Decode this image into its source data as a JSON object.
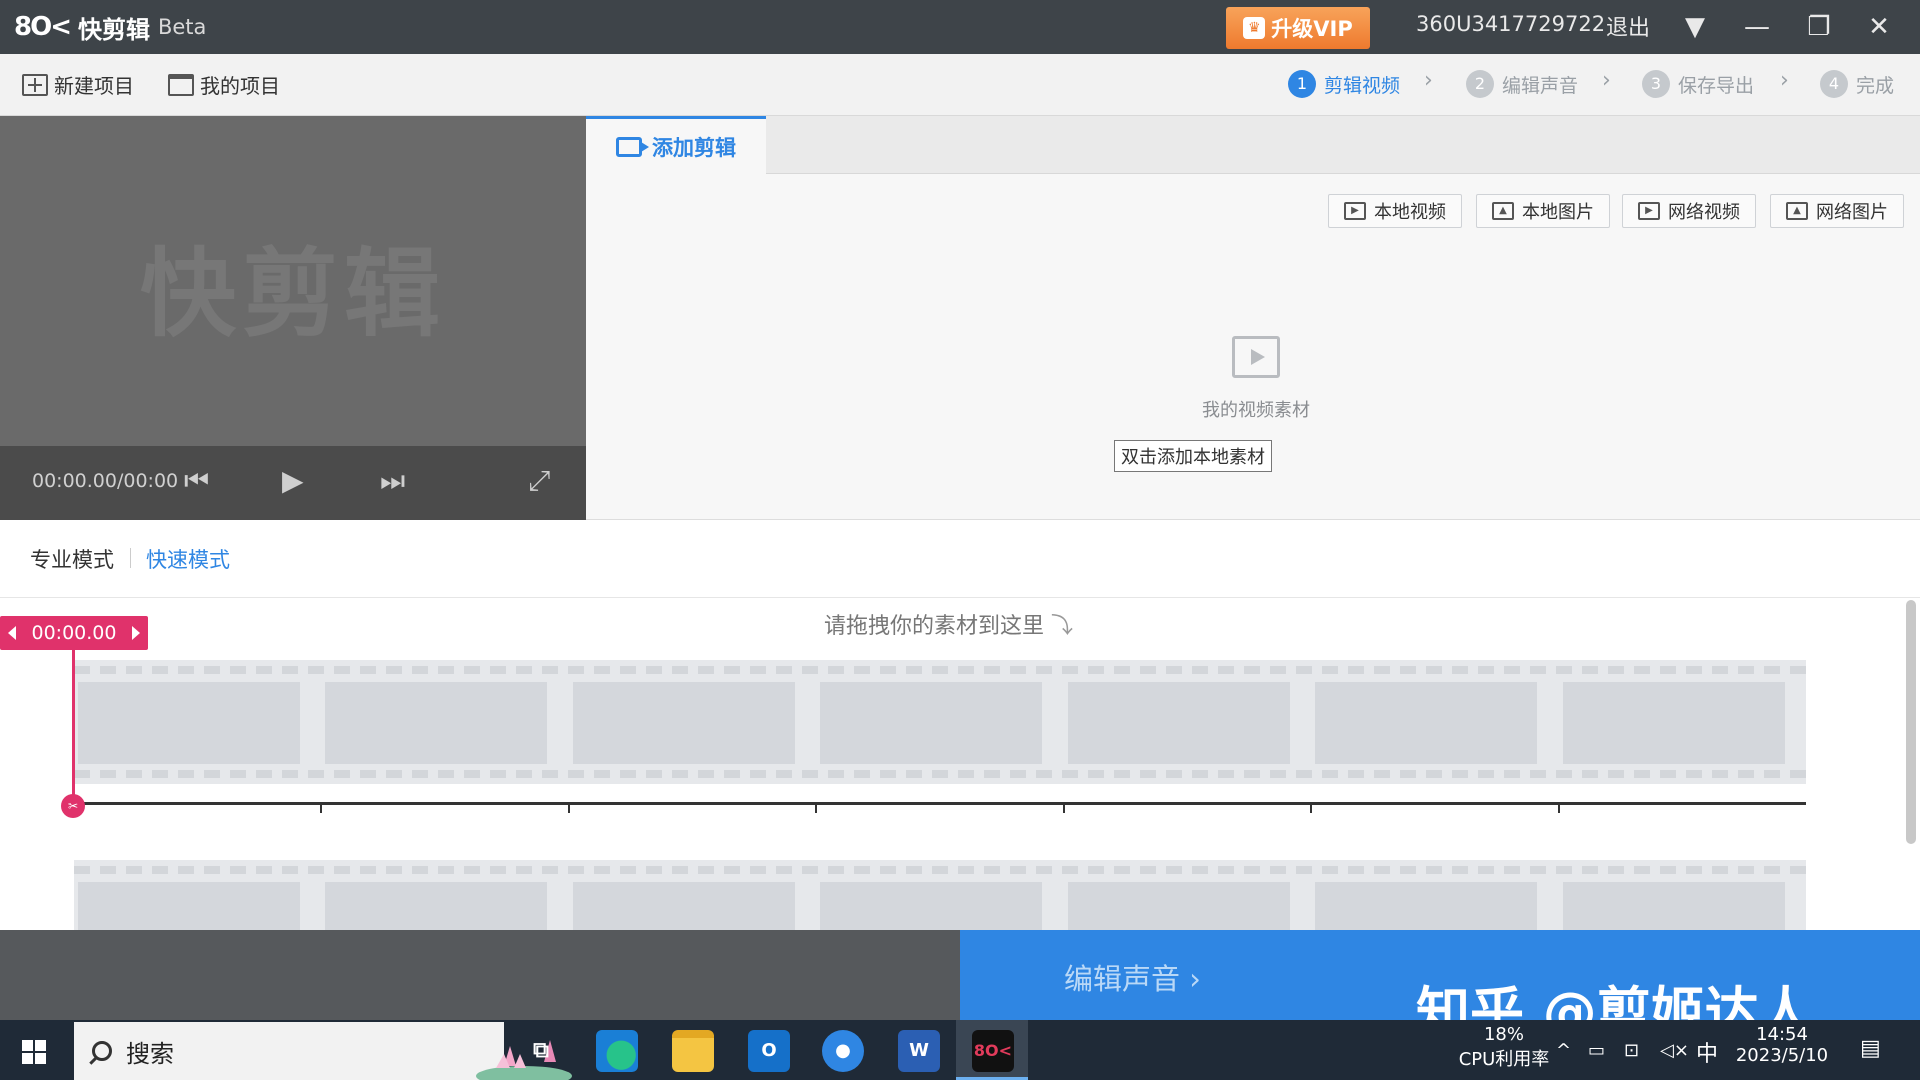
{
  "app": {
    "brand_mark": "8O<",
    "brand_name": "快剪辑",
    "beta": "Beta",
    "vip_label": "升级VIP",
    "user_id": "360U3417729722",
    "logout": "退出"
  },
  "toolbar": {
    "new_project": "新建项目",
    "my_projects": "我的项目",
    "steps": [
      {
        "num": "1",
        "label": "剪辑视频",
        "active": true
      },
      {
        "num": "2",
        "label": "编辑声音",
        "active": false
      },
      {
        "num": "3",
        "label": "保存导出",
        "active": false
      },
      {
        "num": "4",
        "label": "完成",
        "active": false
      }
    ]
  },
  "preview": {
    "watermark": "快剪辑",
    "time": "00:00.00/00:00"
  },
  "material": {
    "tab_label": "添加剪辑",
    "sources": [
      "本地视频",
      "本地图片",
      "网络视频",
      "网络图片"
    ],
    "empty_text": "我的视频素材",
    "tooltip": "双击添加本地素材"
  },
  "modes": {
    "pro": "专业模式",
    "quick": "快速模式"
  },
  "timeline": {
    "drop_hint": "请拖拽你的素材到这里",
    "playhead_time": "00:00.00"
  },
  "actions": {
    "next": "编辑声音",
    "watermark": "知乎 @剪姬达人"
  },
  "taskbar": {
    "search": "搜索",
    "cpu_value": "18%",
    "cpu_label": "CPU利用率",
    "ime": "中",
    "time": "14:54",
    "date": "2023/5/10"
  },
  "colors": {
    "accent": "#2f86e3",
    "playhead": "#e0326b",
    "vip": "#ee7a2e"
  }
}
